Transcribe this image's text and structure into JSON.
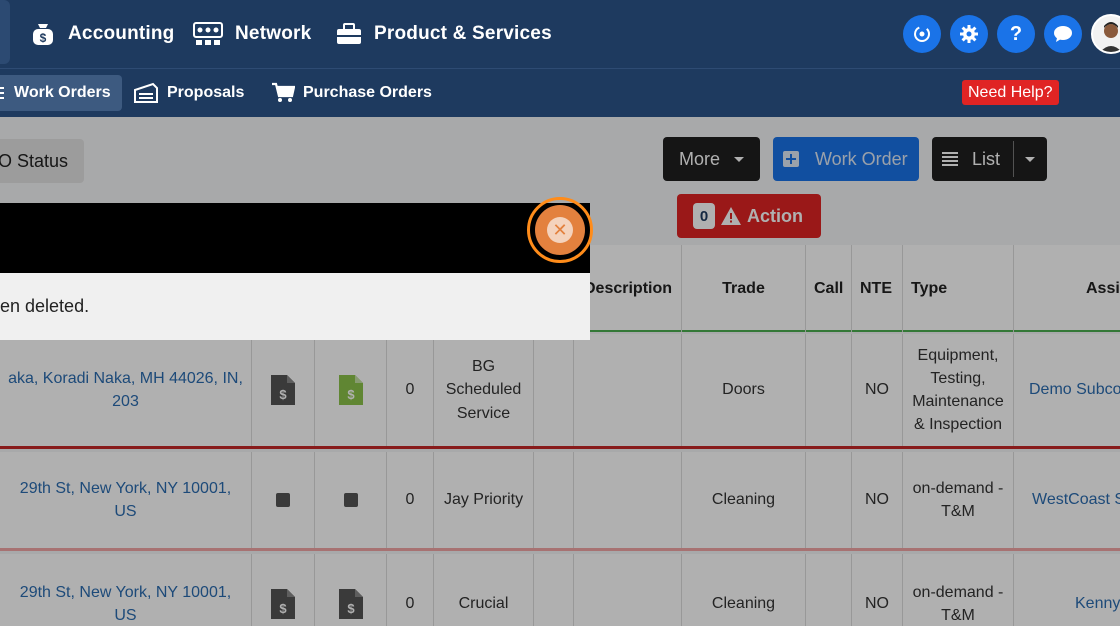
{
  "topnav": {
    "items": [
      {
        "label": "Accounting",
        "icon": "money-bag-icon"
      },
      {
        "label": "Network",
        "icon": "network-icon"
      },
      {
        "label": "Product & Services",
        "icon": "briefcase-icon"
      }
    ],
    "icons": [
      "sync-icon",
      "gear-icon",
      "help-icon",
      "chat-icon"
    ],
    "help_glyph": "?"
  },
  "subnav": {
    "items": [
      {
        "label": "Work Orders",
        "icon": "list-icon"
      },
      {
        "label": "Proposals",
        "icon": "proposal-icon"
      },
      {
        "label": "Purchase Orders",
        "icon": "cart-icon"
      }
    ],
    "need_help": "Need Help?"
  },
  "toolbar": {
    "wo_status_label": "O Status",
    "more_label": "More",
    "work_order_label": "Work Order",
    "list_label": "List",
    "action_count": "0",
    "action_label": "Action"
  },
  "table": {
    "headers": {
      "description": "Description",
      "trade": "Trade",
      "call": "Call",
      "nte": "NTE",
      "type": "Type",
      "assigned": "Assi"
    },
    "rows": [
      {
        "address": "aka, Koradi Naka, MH 44026, IN, 203",
        "count": "0",
        "priority": "BG Scheduled Service",
        "trade": "Doors",
        "nte": "NO",
        "type": "Equipment, Testing, Maintenance & Inspection",
        "assigned": "Demo Subco",
        "row_color": "#c62828"
      },
      {
        "address": "29th St, New York, NY 10001, US",
        "count": "0",
        "priority": "Jay Priority",
        "trade": "Cleaning",
        "nte": "NO",
        "type": "on-demand - T&M",
        "assigned": "WestCoast S",
        "row_color": "#f2a6a6"
      },
      {
        "address": "29th St, New York, NY 10001, US",
        "count": "0",
        "priority": "Crucial",
        "trade": "Cleaning",
        "nte": "NO",
        "type": "on-demand - T&M",
        "assigned": "Kenny",
        "row_color": "#ffffff"
      }
    ]
  },
  "dialog": {
    "message": "en deleted."
  },
  "colors": {
    "nav_bg": "#1e3a5f",
    "accent_blue": "#1a73e8",
    "danger_red": "#e02424",
    "close_orange": "#ff8c1a"
  }
}
